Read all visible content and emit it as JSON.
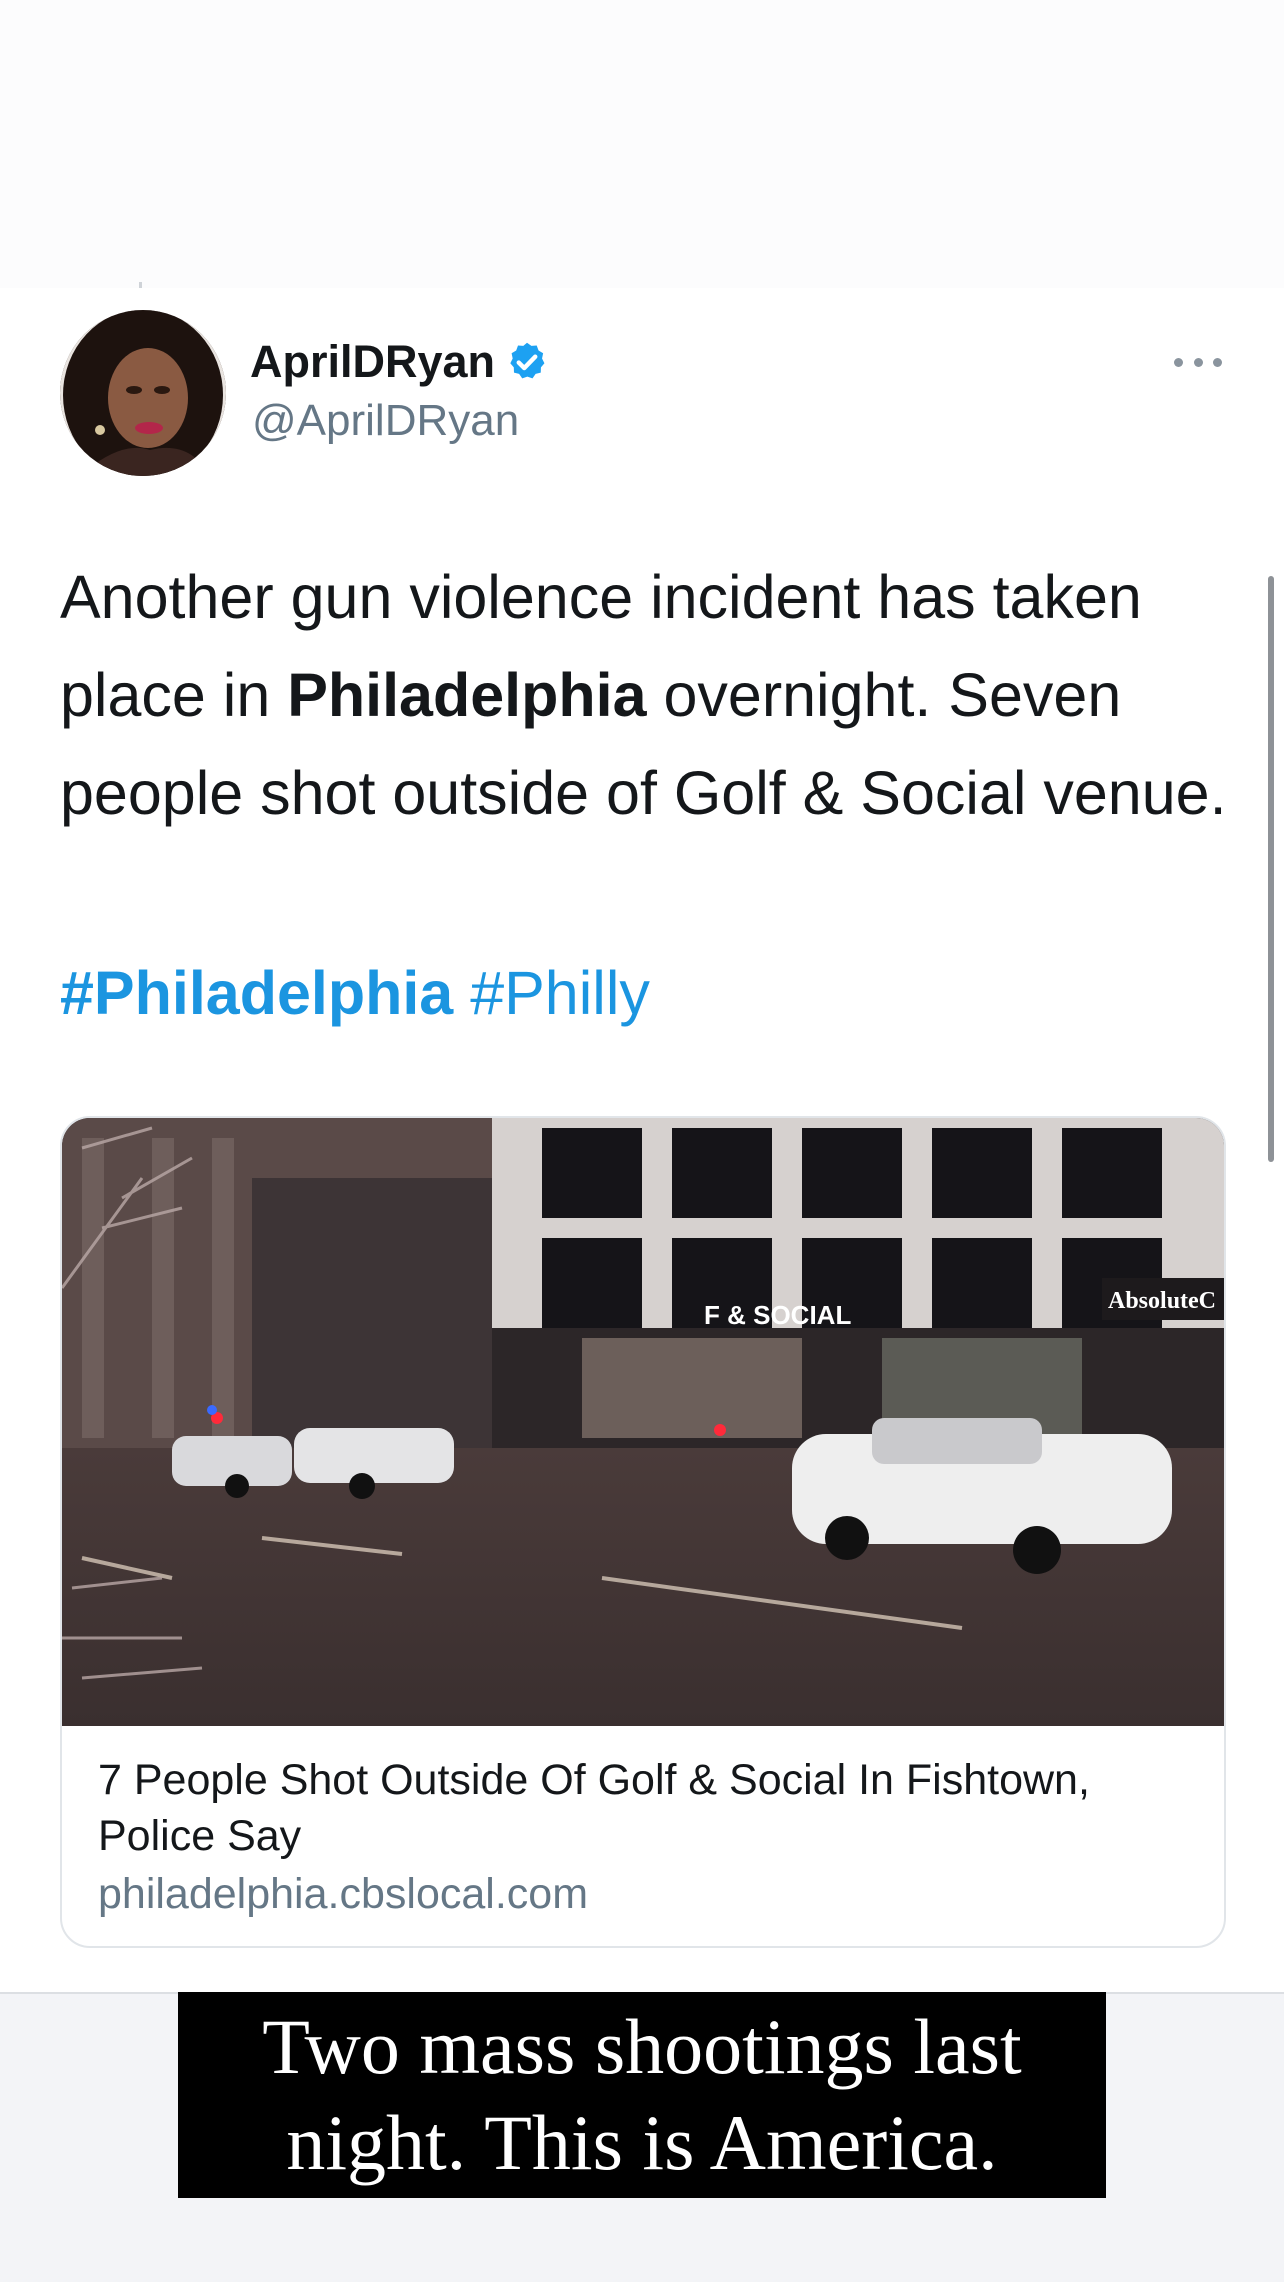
{
  "tweet": {
    "display_name": "AprilDRyan",
    "handle": "@AprilDRyan",
    "verified": true,
    "text_parts": [
      "Another gun violence incident has taken place in ",
      "Philadelphia",
      " overnight. Seven people shot outside of Golf & Social venue."
    ],
    "hashtags": [
      "#Philadelphia",
      "#Philly"
    ],
    "link_card": {
      "title": "7 People Shot Outside Of Golf & Social In Fishtown, Police Say",
      "domain": "philadelphia.cbslocal.com",
      "image_signs": [
        "F & SOCIAL",
        "AbsoluteC"
      ]
    }
  },
  "story_caption": {
    "line1": "Two mass shootings last",
    "line2": "night. This is America."
  },
  "colors": {
    "link_blue": "#1b95e0",
    "text": "#14171a",
    "secondary": "#657786",
    "verified": "#1da1f2"
  },
  "icons": [
    "verified-badge-icon",
    "more-options-icon"
  ]
}
